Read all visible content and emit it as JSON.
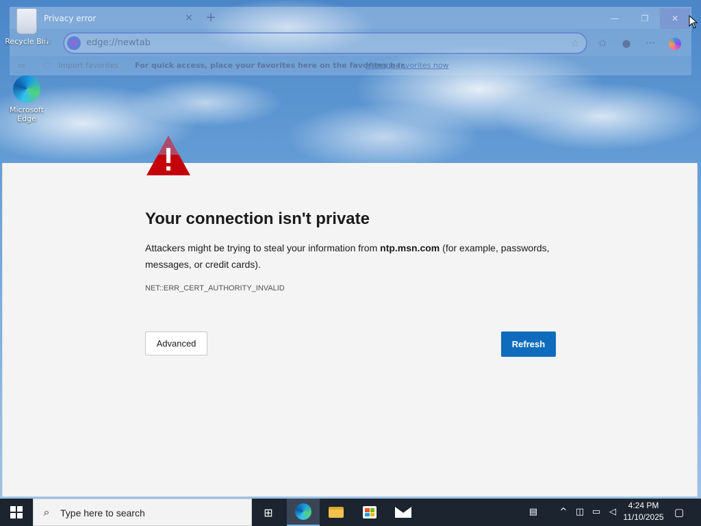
{
  "desktop": {
    "icons": [
      {
        "label": "Recycle Bin",
        "icon": "recycle-bin-icon"
      },
      {
        "label": "Microsoft Edge",
        "icon": "edge-icon"
      }
    ]
  },
  "browser": {
    "tab": {
      "title": "Privacy error",
      "close_glyph": "×"
    },
    "new_tab_glyph": "+",
    "window_controls": {
      "minimize": "—",
      "maximize": "❐",
      "close": "✕"
    },
    "address": {
      "url": "edge://newtab"
    },
    "toolbar_icons": {
      "refresh": "↻",
      "favorite": "☆",
      "favorites": "✩",
      "profile": "●",
      "more": "···"
    },
    "favorites_bar": {
      "import_label": "Import favorites",
      "message": "For quick access, place your favorites here on the favorites bar.",
      "manage_link": "Manage favorites now"
    }
  },
  "page": {
    "title": "Your connection isn't private",
    "description_before": "Attackers might be trying to steal your information from ",
    "host": "ntp.msn.com",
    "description_after": " (for example, passwords, messages, or credit cards).",
    "error_code": "NET::ERR_CERT_AUTHORITY_INVALID",
    "advanced_button": "Advanced",
    "refresh_button": "Refresh",
    "colors": {
      "warning_red": "#c4000b",
      "refresh_blue": "#0f6cbd"
    }
  },
  "taskbar": {
    "search_placeholder": "Type here to search",
    "time": "4:24 PM",
    "date": "11/10/2025",
    "icons": [
      "windows-start-icon",
      "task-view-icon",
      "edge-icon",
      "file-explorer-icon",
      "microsoft-store-icon",
      "mail-icon"
    ]
  }
}
